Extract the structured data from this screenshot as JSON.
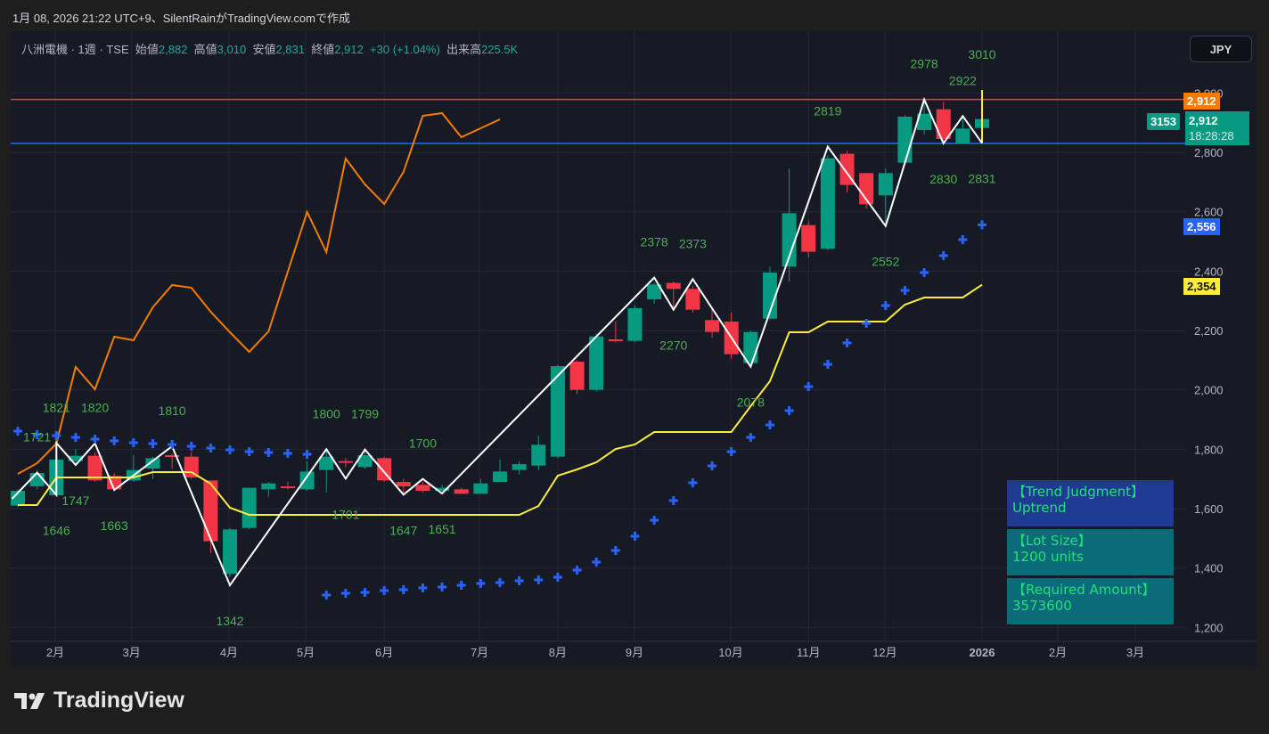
{
  "header": {
    "caption": "1月 08, 2026 21:22 UTC+9、SilentRainがTradingView.comで作成"
  },
  "legend": {
    "symbol": "八洲電機 · 1週 · TSE",
    "open_label": "始値",
    "open": "2,882",
    "high_label": "高値",
    "high": "3,010",
    "low_label": "安値",
    "low": "2,831",
    "close_label": "終値",
    "close": "2,912",
    "change": "+30 (+1.04%)",
    "volume_label": "出来高",
    "volume": "225.5K"
  },
  "currency_button": "JPY",
  "price_axis": {
    "ticks": [
      3000,
      2800,
      2600,
      2400,
      2200,
      2000,
      1800,
      1600,
      1400,
      1200
    ],
    "tick_labels": [
      "3,000",
      "2,800",
      "2,600",
      "2,400",
      "2,200",
      "2,000",
      "1,800",
      "1,600",
      "1,400",
      "1,200"
    ],
    "tags": {
      "resistance": {
        "text": "2,912",
        "price": 2978,
        "color": "#f57c00"
      },
      "last": {
        "text": "2,912",
        "countdown": "18:28:28",
        "price": 2912,
        "color": "#089981"
      },
      "compare": {
        "text": "3153"
      },
      "sar": {
        "text": "2,556",
        "price": 2556,
        "color": "#2962ff"
      },
      "trail": {
        "text": "2,354",
        "price": 2354,
        "color": "#ffeb3b"
      }
    }
  },
  "time_axis": [
    {
      "label": "2月",
      "index": 1.94
    },
    {
      "label": "3月",
      "index": 5.9
    },
    {
      "label": "4月",
      "index": 10.95
    },
    {
      "label": "5月",
      "index": 14.93
    },
    {
      "label": "6月",
      "index": 19
    },
    {
      "label": "7月",
      "index": 23.94
    },
    {
      "label": "8月",
      "index": 28
    },
    {
      "label": "9月",
      "index": 31.98
    },
    {
      "label": "10月",
      "index": 36.97
    },
    {
      "label": "11月",
      "index": 41
    },
    {
      "label": "12月",
      "index": 44.96
    },
    {
      "label": "2026",
      "index": 50,
      "bold": true
    },
    {
      "label": "2月",
      "index": 53.93
    },
    {
      "label": "3月",
      "index": 57.95
    }
  ],
  "chart_data": {
    "type": "candlestick",
    "interval": "1W",
    "colors": {
      "up": "#089981",
      "down": "#f23645",
      "zigzag": "#ffffff",
      "compare": "#f57c00",
      "trail": "#ffeb3b",
      "sar": "#2962ff",
      "resistance": "#f23645",
      "support": "#2962ff",
      "label": "#4caf50"
    },
    "ohlc": [
      [
        1610,
        1665,
        1605,
        1660
      ],
      [
        1675,
        1730,
        1665,
        1720
      ],
      [
        1645,
        1770,
        1645,
        1765
      ],
      [
        1760,
        1800,
        1750,
        1778
      ],
      [
        1778,
        1790,
        1690,
        1695
      ],
      [
        1710,
        1720,
        1660,
        1665
      ],
      [
        1695,
        1780,
        1690,
        1730
      ],
      [
        1735,
        1775,
        1700,
        1770
      ],
      [
        1780,
        1785,
        1735,
        1775
      ],
      [
        1775,
        1790,
        1700,
        1705
      ],
      [
        1695,
        1695,
        1450,
        1490
      ],
      [
        1380,
        1535,
        1370,
        1530
      ],
      [
        1535,
        1670,
        1530,
        1670
      ],
      [
        1665,
        1690,
        1640,
        1685
      ],
      [
        1675,
        1690,
        1665,
        1670
      ],
      [
        1665,
        1760,
        1660,
        1725
      ],
      [
        1730,
        1800,
        1655,
        1775
      ],
      [
        1760,
        1770,
        1740,
        1755
      ],
      [
        1740,
        1795,
        1735,
        1780
      ],
      [
        1770,
        1775,
        1690,
        1695
      ],
      [
        1690,
        1700,
        1650,
        1675
      ],
      [
        1680,
        1690,
        1655,
        1660
      ],
      [
        1660,
        1680,
        1655,
        1670
      ],
      [
        1665,
        1670,
        1650,
        1650
      ],
      [
        1650,
        1700,
        1650,
        1685
      ],
      [
        1690,
        1765,
        1690,
        1725
      ],
      [
        1730,
        1760,
        1715,
        1750
      ],
      [
        1745,
        1845,
        1730,
        1815
      ],
      [
        1775,
        2085,
        1770,
        2080
      ],
      [
        2095,
        2100,
        1985,
        2000
      ],
      [
        2000,
        2190,
        1995,
        2180
      ],
      [
        2170,
        2230,
        2160,
        2165
      ],
      [
        2165,
        2285,
        2160,
        2275
      ],
      [
        2305,
        2360,
        2290,
        2355
      ],
      [
        2360,
        2365,
        2270,
        2340
      ],
      [
        2340,
        2350,
        2260,
        2270
      ],
      [
        2235,
        2270,
        2175,
        2195
      ],
      [
        2230,
        2260,
        2105,
        2120
      ],
      [
        2090,
        2200,
        2085,
        2195
      ],
      [
        2240,
        2415,
        2235,
        2395
      ],
      [
        2415,
        2745,
        2365,
        2595
      ],
      [
        2555,
        2570,
        2445,
        2465
      ],
      [
        2475,
        2790,
        2470,
        2780
      ],
      [
        2795,
        2805,
        2665,
        2690
      ],
      [
        2730,
        2730,
        2610,
        2625
      ],
      [
        2655,
        2745,
        2552,
        2730
      ],
      [
        2765,
        2925,
        2765,
        2920
      ],
      [
        2875,
        2978,
        2860,
        2930
      ],
      [
        2945,
        2970,
        2830,
        2845
      ],
      [
        2830,
        2922,
        2830,
        2880
      ],
      [
        2882,
        3010,
        2831,
        2912
      ]
    ],
    "compare_line": [
      1717,
      1753,
      1819,
      2077,
      2002,
      2179,
      2167,
      2278,
      2353,
      2344,
      2263,
      2194,
      2128,
      2197,
      2398,
      2599,
      2464,
      2779,
      2692,
      2626,
      2734,
      2923,
      2932,
      2851,
      2881,
      2911
    ],
    "trail_line": [
      1612,
      1612,
      1705,
      1705,
      1705,
      1705,
      1705,
      1723,
      1723,
      1723,
      1684,
      1603,
      1579,
      1579,
      1579,
      1579,
      1579,
      1579,
      1579,
      1579,
      1579,
      1579,
      1579,
      1579,
      1579,
      1579,
      1579,
      1609,
      1711,
      1732,
      1756,
      1801,
      1816,
      1858,
      1858,
      1858,
      1858,
      1858,
      1945,
      2029,
      2194,
      2194,
      2230,
      2230,
      2230,
      2230,
      2287,
      2311,
      2311,
      2311,
      2354
    ],
    "sar": [
      1861,
      1849,
      1846,
      1840,
      1834,
      1828,
      1822,
      1819,
      1816,
      1810,
      1804,
      1798,
      1792,
      1789,
      1786,
      1783,
      1309,
      1315,
      1318,
      1324,
      1327,
      1333,
      1336,
      1342,
      1348,
      1351,
      1357,
      1360,
      1369,
      1393,
      1420,
      1459,
      1507,
      1561,
      1627,
      1687,
      1744,
      1792,
      1840,
      1882,
      1930,
      2011,
      2086,
      2158,
      2224,
      2284,
      2335,
      2395,
      2452,
      2506,
      2556
    ],
    "zigzag": [
      [
        -0.3,
        1633
      ],
      [
        1,
        1721
      ],
      [
        2,
        1646
      ],
      [
        2,
        1821
      ],
      [
        3,
        1747
      ],
      [
        4,
        1820
      ],
      [
        5,
        1663
      ],
      [
        8,
        1810
      ],
      [
        11,
        1342
      ],
      [
        16,
        1800
      ],
      [
        17,
        1701
      ],
      [
        18,
        1799
      ],
      [
        20,
        1647
      ],
      [
        21,
        1700
      ],
      [
        22,
        1651
      ],
      [
        33,
        2378
      ],
      [
        34,
        2270
      ],
      [
        35,
        2373
      ],
      [
        38,
        2078
      ],
      [
        42,
        2819
      ],
      [
        45,
        2552
      ],
      [
        47,
        2978
      ],
      [
        48,
        2830
      ],
      [
        49,
        2922
      ],
      [
        50,
        2831
      ]
    ],
    "pivot_labels": [
      {
        "text": "1721",
        "index": 1,
        "price": 1721,
        "kind": "high"
      },
      {
        "text": "1646",
        "index": 2,
        "price": 1646,
        "kind": "low"
      },
      {
        "text": "1821",
        "index": 2,
        "price": 1821,
        "kind": "high"
      },
      {
        "text": "1747",
        "index": 3,
        "price": 1747,
        "kind": "low"
      },
      {
        "text": "1820",
        "index": 4,
        "price": 1820,
        "kind": "high"
      },
      {
        "text": "1663",
        "index": 5,
        "price": 1663,
        "kind": "low"
      },
      {
        "text": "1810",
        "index": 8,
        "price": 1810,
        "kind": "high"
      },
      {
        "text": "1342",
        "index": 11,
        "price": 1342,
        "kind": "low"
      },
      {
        "text": "1800",
        "index": 16,
        "price": 1800,
        "kind": "high"
      },
      {
        "text": "1701",
        "index": 17,
        "price": 1701,
        "kind": "low"
      },
      {
        "text": "1799",
        "index": 18,
        "price": 1799,
        "kind": "high"
      },
      {
        "text": "1647",
        "index": 20,
        "price": 1647,
        "kind": "low"
      },
      {
        "text": "1700",
        "index": 21,
        "price": 1700,
        "kind": "high"
      },
      {
        "text": "1651",
        "index": 22,
        "price": 1651,
        "kind": "low"
      },
      {
        "text": "2378",
        "index": 33,
        "price": 2378,
        "kind": "high"
      },
      {
        "text": "2270",
        "index": 34,
        "price": 2270,
        "kind": "low"
      },
      {
        "text": "2373",
        "index": 35,
        "price": 2373,
        "kind": "high"
      },
      {
        "text": "2078",
        "index": 38,
        "price": 2078,
        "kind": "low"
      },
      {
        "text": "2819",
        "index": 42,
        "price": 2819,
        "kind": "high"
      },
      {
        "text": "2552",
        "index": 45,
        "price": 2552,
        "kind": "low"
      },
      {
        "text": "2978",
        "index": 47,
        "price": 2978,
        "kind": "high"
      },
      {
        "text": "2830",
        "index": 48,
        "price": 2830,
        "kind": "low"
      },
      {
        "text": "2922",
        "index": 49,
        "price": 2922,
        "kind": "high"
      },
      {
        "text": "3010",
        "index": 50,
        "price": 3010,
        "kind": "high"
      },
      {
        "text": "2831",
        "index": 50,
        "price": 2831,
        "kind": "low"
      }
    ],
    "resistance": 2978,
    "support": 2830,
    "current_bar_range": [
      2831,
      3010
    ]
  },
  "info_panel": [
    {
      "title": "【Trend Judgment】",
      "value": "Uptrend",
      "bg": "#1f3a93"
    },
    {
      "title": "【Lot Size】",
      "value": "1200 units",
      "bg": "#0b6b78"
    },
    {
      "title": "【Required Amount】",
      "value": "3573600",
      "bg": "#0b6b78"
    }
  ],
  "branding": {
    "name": "TradingView"
  }
}
